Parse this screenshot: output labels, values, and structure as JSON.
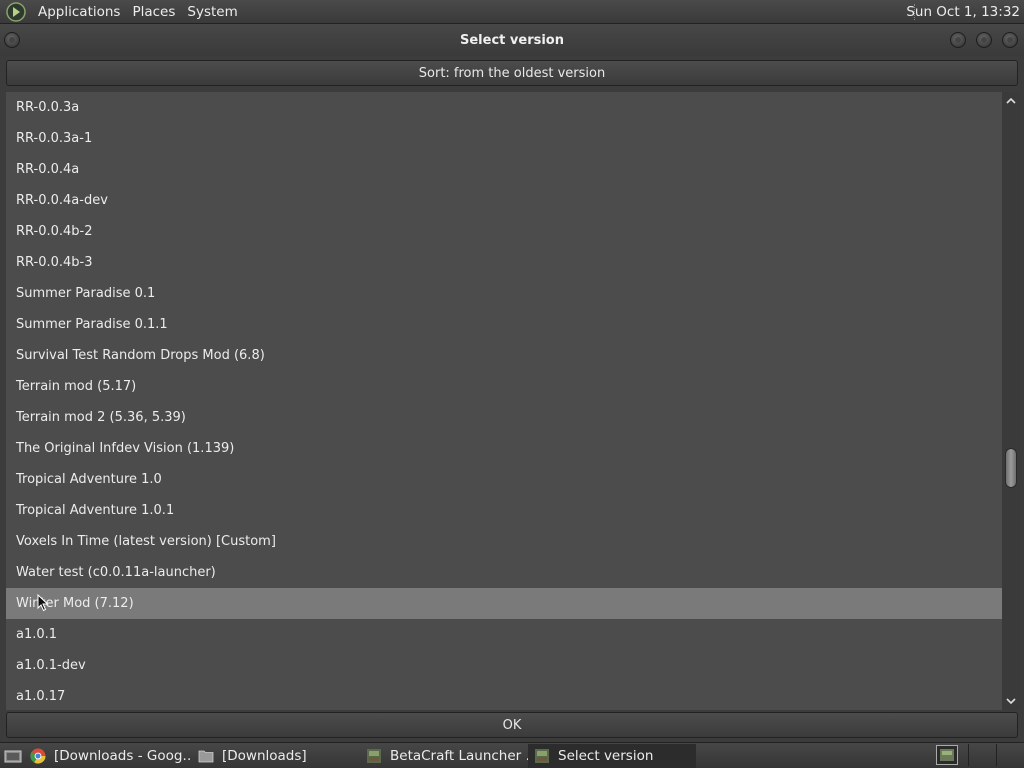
{
  "top_panel": {
    "menus": [
      "Applications",
      "Places",
      "System"
    ],
    "clock": "Sun Oct  1, 13:32"
  },
  "window": {
    "title": "Select version",
    "sort_label": "Sort: from the oldest version",
    "ok_label": "OK"
  },
  "versions": [
    "RR-0.0.3a",
    "RR-0.0.3a-1",
    "RR-0.0.4a",
    "RR-0.0.4a-dev",
    "RR-0.0.4b-2",
    "RR-0.0.4b-3",
    "Summer Paradise 0.1",
    "Summer Paradise 0.1.1",
    "Survival Test Random Drops Mod (6.8)",
    "Terrain mod (5.17)",
    "Terrain mod 2 (5.36, 5.39)",
    "The Original Infdev Vision (1.139)",
    "Tropical Adventure 1.0",
    "Tropical Adventure 1.0.1",
    "Voxels In Time (latest version) [Custom]",
    "Water test (c0.0.11a-launcher)",
    "Winter Mod (7.12)",
    "a1.0.1",
    "a1.0.1-dev",
    "a1.0.17"
  ],
  "selected_index": 16,
  "taskbar": {
    "tasks": [
      {
        "label": "[Downloads - Goog…",
        "icon": "chrome-icon"
      },
      {
        "label": "[Downloads]",
        "icon": "folder-icon"
      },
      {
        "label": "BetaCraft Launcher …",
        "icon": "betacraft-icon"
      },
      {
        "label": "Select version",
        "icon": "betacraft-icon"
      }
    ],
    "active_task": 3
  },
  "colors": {
    "list_bg": "#4c4c4c",
    "selected_bg": "#7a7a7a",
    "panel_bg": "#3c3c3c"
  }
}
